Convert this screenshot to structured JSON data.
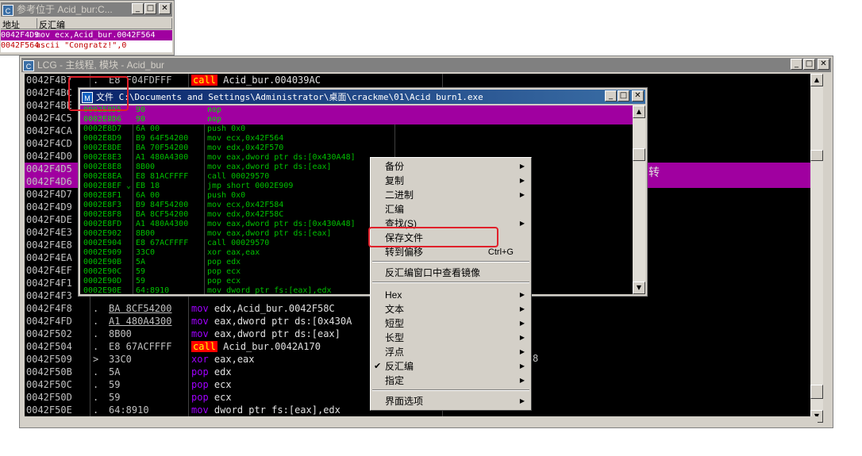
{
  "ref_window": {
    "title": "参考位于 Acid_bur:C...",
    "col_addr": "地址",
    "col_disasm": "反汇编",
    "rows": [
      {
        "addr": "0042F4D9",
        "text": "mov ecx,Acid_bur.0042F564"
      },
      {
        "addr": "0042F564",
        "text": "ascii \"Congratz!\",0"
      }
    ]
  },
  "main_window": {
    "title": "LCG - 主线程, 模块 - Acid_bur",
    "icon": "C",
    "extra_text_1": "转",
    "extra_text_2": "8",
    "rows": [
      {
        "addr": "0042F4B7",
        "mark": ".",
        "hex": "E8 F04FDFFF",
        "op": "call",
        "args": "Acid_bur.004039AC"
      },
      {
        "addr": "0042F4BC",
        "mark": "",
        "hex": "",
        "op": "",
        "args": ""
      },
      {
        "addr": "0042F4BE",
        "mark": "",
        "hex": "",
        "op": "",
        "args": ""
      },
      {
        "addr": "0042F4C5",
        "mark": "",
        "hex": "",
        "op": "",
        "args": ""
      },
      {
        "addr": "0042F4CA",
        "mark": "",
        "hex": "",
        "op": "",
        "args": ""
      },
      {
        "addr": "0042F4CD",
        "mark": "",
        "hex": "",
        "op": "",
        "args": ""
      },
      {
        "addr": "0042F4D0",
        "mark": "",
        "hex": "",
        "op": "",
        "args": ""
      },
      {
        "addr": "0042F4D5",
        "mark": "",
        "hex": "",
        "op": "",
        "args": ""
      },
      {
        "addr": "0042F4D6",
        "mark": "",
        "hex": "",
        "op": "",
        "args": ""
      },
      {
        "addr": "0042F4D7",
        "mark": "",
        "hex": "",
        "op": "",
        "args": ""
      },
      {
        "addr": "0042F4D9",
        "mark": "",
        "hex": "",
        "op": "",
        "args": ""
      },
      {
        "addr": "0042F4DE",
        "mark": "",
        "hex": "",
        "op": "",
        "args": ""
      },
      {
        "addr": "0042F4E3",
        "mark": "",
        "hex": "",
        "op": "",
        "args": ""
      },
      {
        "addr": "0042F4E8",
        "mark": "",
        "hex": "",
        "op": "",
        "args": ""
      },
      {
        "addr": "0042F4EA",
        "mark": "",
        "hex": "",
        "op": "",
        "args": ""
      },
      {
        "addr": "0042F4EF",
        "mark": "",
        "hex": "",
        "op": "",
        "args": ""
      },
      {
        "addr": "0042F4F1",
        "mark": "",
        "hex": "",
        "op": "",
        "args": ""
      },
      {
        "addr": "0042F4F3",
        "mark": "",
        "hex": "",
        "op": "",
        "args": ""
      },
      {
        "addr": "0042F4F8",
        "mark": ".",
        "hex": "BA 8CF54200",
        "op": "mov",
        "args": "edx,Acid_bur.0042F58C"
      },
      {
        "addr": "0042F4FD",
        "mark": ".",
        "hex": "A1 480A4300",
        "op": "mov",
        "args": "eax,dword ptr ds:[0x430A"
      },
      {
        "addr": "0042F502",
        "mark": ".",
        "hex": "8B00",
        "op": "mov",
        "args": "eax,dword ptr ds:[eax]"
      },
      {
        "addr": "0042F504",
        "mark": ".",
        "hex": "E8 67ACFFFF",
        "op": "call",
        "args": "Acid_bur.0042A170"
      },
      {
        "addr": "0042F509",
        "mark": ">",
        "hex": "33C0",
        "op": "xor",
        "args": "eax,eax"
      },
      {
        "addr": "0042F50B",
        "mark": ".",
        "hex": "5A",
        "op": "pop",
        "args": "edx"
      },
      {
        "addr": "0042F50C",
        "mark": ".",
        "hex": "59",
        "op": "pop",
        "args": "ecx"
      },
      {
        "addr": "0042F50D",
        "mark": ".",
        "hex": "59",
        "op": "pop",
        "args": "ecx"
      },
      {
        "addr": "0042F50E",
        "mark": ".",
        "hex": "64:8910",
        "op": "mov",
        "args": "dword ptr fs:[eax],edx"
      }
    ]
  },
  "file_window": {
    "title": "文件 C:\\Documents and Settings\\Administrator\\桌面\\crackme\\01\\Acid burn1.exe",
    "icon": "M",
    "rows": [
      {
        "addr": "0002E8D5",
        "mark": "",
        "hex": "90",
        "dis": "nop",
        "hl": true
      },
      {
        "addr": "0002E8D6",
        "mark": "",
        "hex": "90",
        "dis": "nop",
        "hl": true
      },
      {
        "addr": "0002E8D7",
        "mark": "",
        "hex": "6A 00",
        "dis": "push 0x0",
        "hl": false
      },
      {
        "addr": "0002E8D9",
        "mark": "",
        "hex": "B9 64F54200",
        "dis": "mov ecx,0x42F564",
        "hl": false
      },
      {
        "addr": "0002E8DE",
        "mark": "",
        "hex": "BA 70F54200",
        "dis": "mov edx,0x42F570",
        "hl": false
      },
      {
        "addr": "0002E8E3",
        "mark": "",
        "hex": "A1 480A4300",
        "dis": "mov eax,dword ptr ds:[0x430A48]",
        "hl": false
      },
      {
        "addr": "0002E8E8",
        "mark": "",
        "hex": "8B00",
        "dis": "mov eax,dword ptr ds:[eax]",
        "hl": false
      },
      {
        "addr": "0002E8EA",
        "mark": "",
        "hex": "E8 81ACFFFF",
        "dis": "call 00029570",
        "hl": false
      },
      {
        "addr": "0002E8EF",
        "mark": "⌄",
        "hex": "EB 18",
        "dis": "jmp short 0002E909",
        "hl": false
      },
      {
        "addr": "0002E8F1",
        "mark": "",
        "hex": "6A 00",
        "dis": "push 0x0",
        "hl": false
      },
      {
        "addr": "0002E8F3",
        "mark": "",
        "hex": "B9 84F54200",
        "dis": "mov ecx,0x42F584",
        "hl": false
      },
      {
        "addr": "0002E8F8",
        "mark": "",
        "hex": "BA 8CF54200",
        "dis": "mov edx,0x42F58C",
        "hl": false
      },
      {
        "addr": "0002E8FD",
        "mark": "",
        "hex": "A1 480A4300",
        "dis": "mov eax,dword ptr ds:[0x430A48]",
        "hl": false
      },
      {
        "addr": "0002E902",
        "mark": "",
        "hex": "8B00",
        "dis": "mov eax,dword ptr ds:[eax]",
        "hl": false
      },
      {
        "addr": "0002E904",
        "mark": "",
        "hex": "E8 67ACFFFF",
        "dis": "call 00029570",
        "hl": false
      },
      {
        "addr": "0002E909",
        "mark": "",
        "hex": "33C0",
        "dis": "xor eax,eax",
        "hl": false
      },
      {
        "addr": "0002E90B",
        "mark": "",
        "hex": "5A",
        "dis": "pop edx",
        "hl": false
      },
      {
        "addr": "0002E90C",
        "mark": "",
        "hex": "59",
        "dis": "pop ecx",
        "hl": false
      },
      {
        "addr": "0002E90D",
        "mark": "",
        "hex": "59",
        "dis": "pop ecx",
        "hl": false
      },
      {
        "addr": "0002E90E",
        "mark": "",
        "hex": "64:8910",
        "dis": "mov dword ptr fs:[eax],edx",
        "hl": false
      }
    ]
  },
  "context_menu": {
    "items": [
      {
        "label": "备份",
        "arrow": true
      },
      {
        "label": "复制",
        "arrow": true
      },
      {
        "label": "二进制",
        "arrow": true
      },
      {
        "label": "汇编",
        "arrow": false
      },
      {
        "label": "查找(S)",
        "arrow": true
      },
      {
        "label": "保存文件",
        "arrow": false
      },
      {
        "label": "转到偏移",
        "shortcut": "Ctrl+G"
      },
      {
        "label": "反汇编窗口中查看镜像",
        "arrow": false
      },
      {
        "label": "Hex",
        "arrow": true
      },
      {
        "label": "文本",
        "arrow": true
      },
      {
        "label": "短型",
        "arrow": true
      },
      {
        "label": "长型",
        "arrow": true
      },
      {
        "label": "浮点",
        "arrow": true
      },
      {
        "label": "反汇编",
        "arrow": true,
        "checked": true
      },
      {
        "label": "指定",
        "arrow": true
      },
      {
        "label": "界面选项",
        "arrow": true
      }
    ]
  },
  "window_buttons": {
    "min": "_",
    "max": "□",
    "close": "✕"
  },
  "colors": {
    "highlight": "#a000a0",
    "annotation": "#e0202a",
    "call_bg": "#ff0000"
  }
}
